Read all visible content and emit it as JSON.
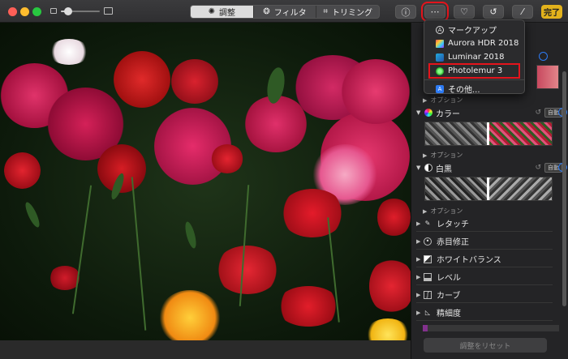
{
  "toolbar": {
    "tabs": [
      {
        "label": "調整",
        "icon": "sun-dial-icon",
        "active": true
      },
      {
        "label": "フィルタ",
        "icon": "filter-circles-icon",
        "active": false
      },
      {
        "label": "トリミング",
        "icon": "crop-icon",
        "active": false
      }
    ],
    "buttons": {
      "info_icon": "ⓘ",
      "extensions_icon": "⋯",
      "favorite_icon": "♡",
      "rotate_icon": "↺",
      "auto_enhance_icon": "⁄"
    },
    "done_label": "完了",
    "accent_color": "#e2b21c"
  },
  "zoom": {
    "level_percent": 18
  },
  "extensions_menu": {
    "items": [
      {
        "label": "マークアップ",
        "icon": "markup-icon"
      },
      {
        "label": "Aurora HDR 2018",
        "icon": "aurora-hdr-icon"
      },
      {
        "label": "Luminar 2018",
        "icon": "luminar-icon"
      },
      {
        "label": "Photolemur 3",
        "icon": "photolemur-icon",
        "highlighted": true
      }
    ],
    "more_label": "その他...",
    "highlight_color": "#e4141c"
  },
  "sidebar": {
    "option_label": "オプション",
    "sections": [
      {
        "label": "カラー",
        "auto": "自動"
      },
      {
        "label": "白黒",
        "auto": "自動"
      }
    ],
    "rows": [
      {
        "label": "レタッチ",
        "icon": "bandage-icon"
      },
      {
        "label": "赤目修正",
        "icon": "eye-icon"
      },
      {
        "label": "ホワイトバランス",
        "icon": "white-balance-icon"
      },
      {
        "label": "レベル",
        "icon": "levels-icon"
      },
      {
        "label": "カーブ",
        "icon": "curves-icon"
      },
      {
        "label": "精細度",
        "icon": "definition-icon"
      }
    ],
    "reset_label": "調整をリセット"
  }
}
